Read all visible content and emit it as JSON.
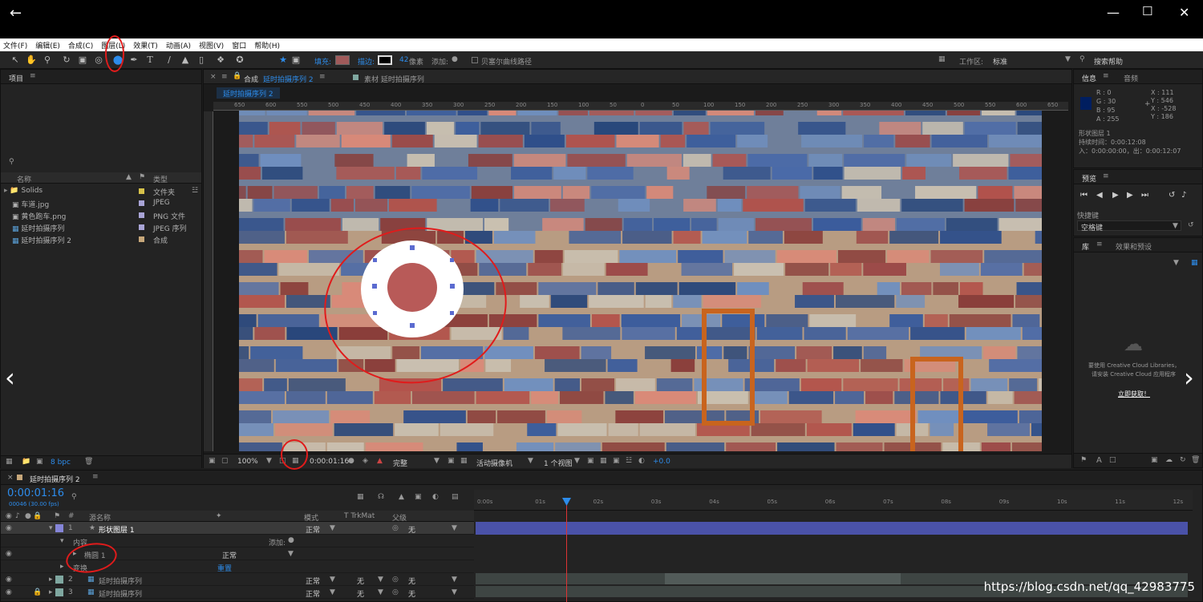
{
  "menu": [
    "文件(F)",
    "编辑(E)",
    "合成(C)",
    "图层(L)",
    "效果(T)",
    "动画(A)",
    "视图(V)",
    "窗口",
    "帮助(H)"
  ],
  "toolbar": {
    "fill_label": "填充:",
    "stroke_label": "描边:",
    "stroke_width": "42",
    "stroke_unit": "像素",
    "add_label": "添加:",
    "bezier_label": "贝塞尔曲线路径",
    "workspace_label": "工作区:",
    "workspace_value": "标准",
    "search_help": "搜索帮助"
  },
  "project": {
    "tab": "项目",
    "col_name": "名称",
    "col_type": "类型",
    "items": [
      {
        "name": "Solids",
        "type": "文件夹",
        "color": "#d6c14a"
      },
      {
        "name": "车道.jpg",
        "type": "JPEG",
        "color": "#a9a4d6"
      },
      {
        "name": "黄色跑车.png",
        "type": "PNG 文件",
        "color": "#a9a4d6"
      },
      {
        "name": "延时拍摄序列",
        "type": "JPEG 序列",
        "color": "#a9a4d6"
      },
      {
        "name": "延时拍摄序列 2",
        "type": "合成",
        "color": "#c7a77a"
      }
    ],
    "bpc": "8 bpc"
  },
  "comp": {
    "tab_label": "合成",
    "tab_name": "延时拍摄序列 2",
    "footage_tab": "素材 延时拍摄序列",
    "comp_crumb": "延时拍摄序列 2",
    "zoom": "100%",
    "timecode": "0:00:01:16",
    "quality": "完整",
    "camera": "活动摄像机",
    "views": "1 个视图",
    "exposure": "+0.0",
    "ruler_labels": [
      "650",
      "600",
      "550",
      "500",
      "450",
      "400",
      "350",
      "300",
      "250",
      "200",
      "150",
      "100",
      "50",
      "0",
      "50",
      "100",
      "150",
      "200",
      "250",
      "300",
      "350",
      "400",
      "450",
      "500",
      "550",
      "600",
      "650"
    ]
  },
  "info": {
    "tab": "信息",
    "tab2": "音频",
    "r": "R : 0",
    "g": "G : 30",
    "b": "B : 95",
    "a": "A : 255",
    "x1": "X : 111",
    "y1": "Y : 546",
    "x2": "X : -528",
    "y2": "Y : 186",
    "layer_name": "形状图层 1",
    "duration": "持续时间：0:00:12:08",
    "inout": "入：0:00:00:00，出：0:00:12:07",
    "swatch_color": "#001e5f"
  },
  "preview": {
    "tab": "预览",
    "shortcut_label": "快捷键",
    "shortcut_value": "空格键"
  },
  "library": {
    "tab": "库",
    "tab2": "效果和预设",
    "msg1": "要使用 Creative Cloud Libraries，",
    "msg2": "请安装 Creative Cloud 应用程序",
    "cta": "立即获取！"
  },
  "timeline": {
    "tab": "延时拍摄序列 2",
    "timecode": "0:00:01:16",
    "frames": "00046 (30.00 fps)",
    "col_source": "源名称",
    "col_mode": "模式",
    "col_trk": "T TrkMat",
    "col_parent": "父级",
    "ticks": [
      "0:00s",
      "01s",
      "02s",
      "03s",
      "04s",
      "05s",
      "06s",
      "07s",
      "08s",
      "09s",
      "10s",
      "11s",
      "12s"
    ],
    "layers": [
      {
        "num": "1",
        "name": "形状图层 1",
        "mode": "正常",
        "parent": "无",
        "label_color": "#8585d8"
      },
      {
        "num": "2",
        "name": "延时拍摄序列",
        "mode": "正常",
        "trk": "无",
        "parent": "无",
        "label_color": "#7fa7a0"
      },
      {
        "num": "3",
        "name": "延时拍摄序列",
        "mode": "正常",
        "trk": "无",
        "parent": "无",
        "label_color": "#7fa7a0"
      }
    ],
    "contents": "内容",
    "add": "添加:",
    "ellipse": "椭圆 1",
    "ellipse_mode": "正常",
    "transform": "变换",
    "reset": "重置"
  },
  "watermark": "https://blog.csdn.net/qq_42983775"
}
